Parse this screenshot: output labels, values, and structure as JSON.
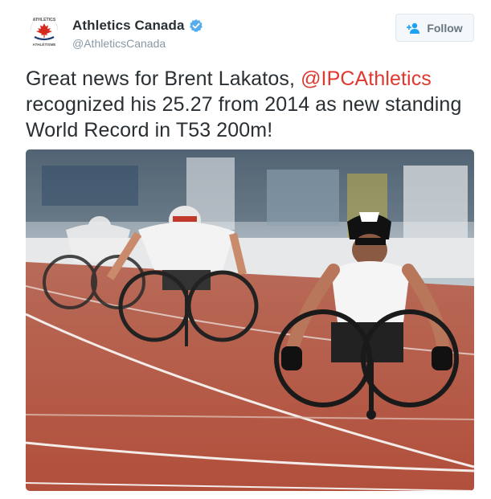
{
  "account": {
    "display_name": "Athletics Canada",
    "handle": "@AthleticsCanada",
    "avatar_icon": "athletics-canada-logo",
    "verified_icon": "verified-badge-icon"
  },
  "follow_button": {
    "label": "Follow",
    "icon": "add-user-icon"
  },
  "tweet": {
    "text_before": "Great news for Brent Lakatos, ",
    "mention": "@IPCAthletics",
    "text_after": " recognized his 25.27 from 2014 as new standing World Record in T53 200m!"
  },
  "media": {
    "type": "photo",
    "subject": "wheelchair-racers-on-track"
  },
  "colors": {
    "mention": "#e0382e",
    "verified": "#55acee",
    "track": "#b5543f"
  }
}
